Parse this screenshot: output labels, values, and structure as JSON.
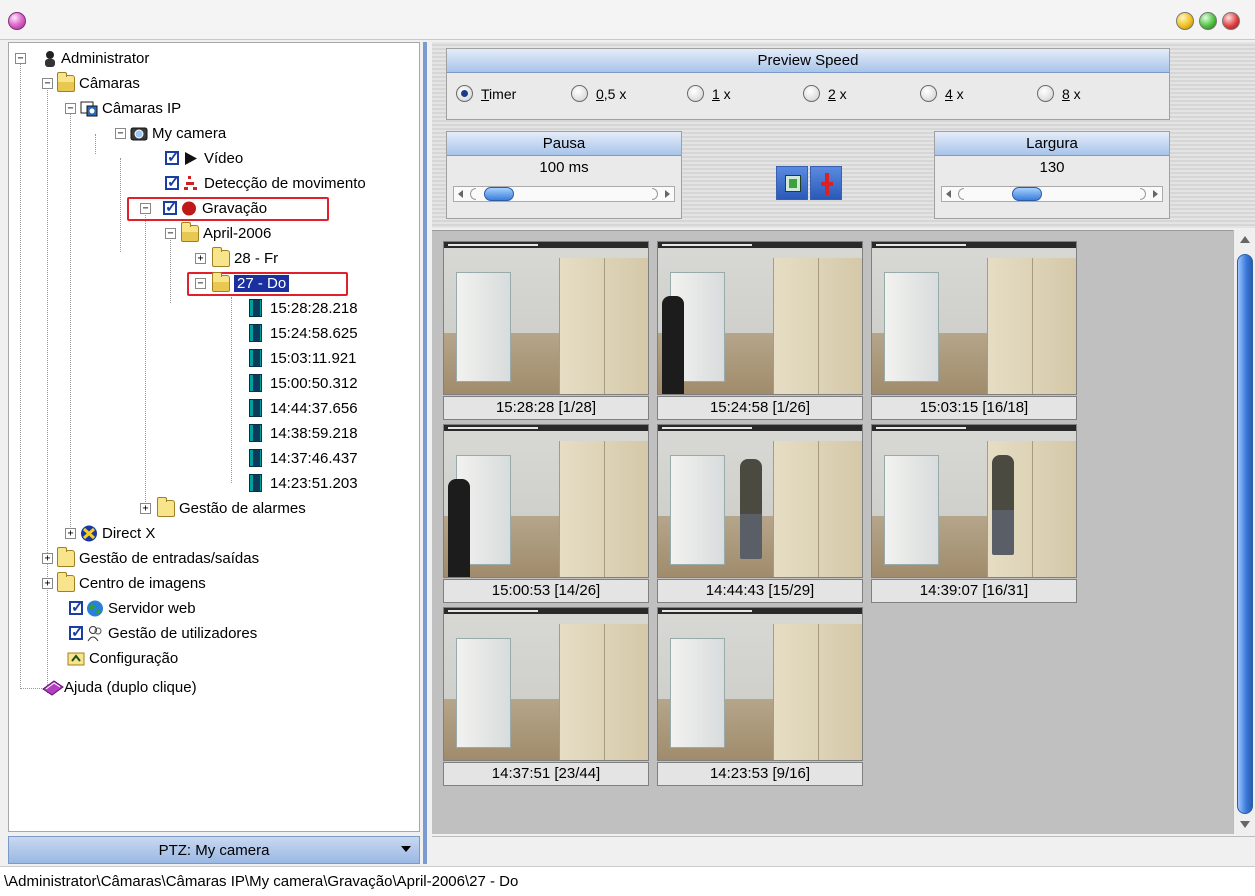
{
  "tree": {
    "root": "Administrator",
    "cameras": "Câmaras",
    "ip_cameras": "Câmaras IP",
    "my_camera": "My camera",
    "video": "Vídeo",
    "motion": "Detecção de movimento",
    "recording": "Gravação",
    "month": "April-2006",
    "day_28": "28 - Fr",
    "day_27": "27 - Do",
    "recordings": [
      "15:28:28.218",
      "15:24:58.625",
      "15:03:11.921",
      "15:00:50.312",
      "14:44:37.656",
      "14:38:59.218",
      "14:37:46.437",
      "14:23:51.203"
    ],
    "alarm_mgmt": "Gestão de alarmes",
    "direct_x": "Direct X",
    "io_mgmt": "Gestão de entradas/saídas",
    "image_center": "Centro de imagens",
    "web_server": "Servidor web",
    "user_mgmt": "Gestão de utilizadores",
    "config": "Configuração",
    "help": "Ajuda (duplo clique)"
  },
  "ptz": {
    "label": "PTZ: My camera"
  },
  "preview": {
    "title": "Preview Speed",
    "options": [
      {
        "label": "Timer",
        "selected": true
      },
      {
        "label": "0,5 x",
        "selected": false
      },
      {
        "label": "1 x",
        "selected": false
      },
      {
        "label": "2 x",
        "selected": false
      },
      {
        "label": "4 x",
        "selected": false
      },
      {
        "label": "8 x",
        "selected": false
      }
    ]
  },
  "pause": {
    "title": "Pausa",
    "value": "100 ms"
  },
  "width": {
    "title": "Largura",
    "value": "130"
  },
  "thumbnails": [
    {
      "caption": "15:28:28 [1/28]",
      "person": "none"
    },
    {
      "caption": "15:24:58 [1/26]",
      "person": "dark-left"
    },
    {
      "caption": "15:03:15 [16/18]",
      "person": "none"
    },
    {
      "caption": "15:00:53 [14/26]",
      "person": "dark-left"
    },
    {
      "caption": "14:44:43 [15/29]",
      "person": "center"
    },
    {
      "caption": "14:39:07 [16/31]",
      "person": "right"
    },
    {
      "caption": "14:37:51 [23/44]",
      "person": "none"
    },
    {
      "caption": "14:23:53 [9/16]",
      "person": "none"
    }
  ],
  "status": {
    "path": "\\Administrator\\Câmaras\\Câmaras IP\\My camera\\Gravação\\April-2006\\27 - Do"
  },
  "colors": {
    "selection": "#1a2fa0",
    "highlight_box": "#e0202a",
    "header_blue": "#a8c4ea"
  }
}
